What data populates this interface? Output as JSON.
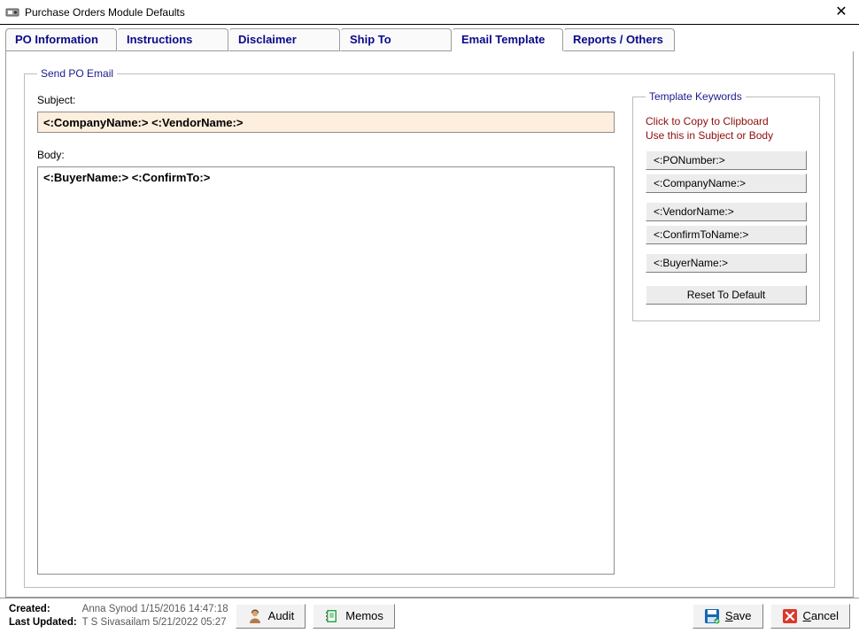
{
  "window": {
    "title": "Purchase Orders Module Defaults"
  },
  "tabs": [
    {
      "label": "PO Information"
    },
    {
      "label": "Instructions"
    },
    {
      "label": "Disclaimer"
    },
    {
      "label": "Ship To"
    },
    {
      "label": "Email Template"
    },
    {
      "label": "Reports / Others"
    }
  ],
  "active_tab_index": 4,
  "legend": {
    "main": "Send PO Email",
    "keywords": "Template Keywords"
  },
  "form": {
    "subject_label": "Subject:",
    "subject_value": "<:CompanyName:> <:VendorName:>",
    "body_label": "Body:",
    "body_value": "<:BuyerName:> <:ConfirmTo:>"
  },
  "keywords": {
    "hint1": "Click to Copy to Clipboard",
    "hint2": "Use this in Subject or Body",
    "items": [
      "<:PONumber:>",
      "<:CompanyName:>",
      "<:VendorName:>",
      "<:ConfirmToName:>",
      "<:BuyerName:>"
    ],
    "reset_label": "Reset To Default"
  },
  "footer": {
    "created_label": "Created:",
    "created_value": "Anna Synod 1/15/2016 14:47:18",
    "updated_label": "Last Updated:",
    "updated_value": "T S Sivasailam 5/21/2022 05:27",
    "audit_label": "Audit",
    "memos_label": "Memos",
    "save_label": "Save",
    "cancel_label": "Cancel"
  }
}
